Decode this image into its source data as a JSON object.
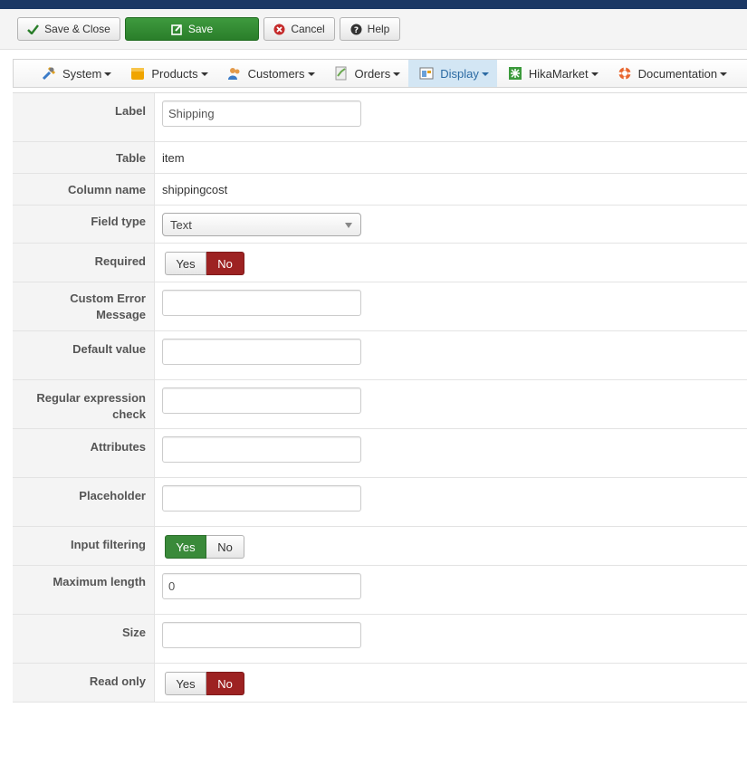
{
  "toolbar": {
    "save_close": "Save & Close",
    "save": "Save",
    "cancel": "Cancel",
    "help": "Help"
  },
  "menu": {
    "items": [
      {
        "label": "System",
        "icon": "tools-icon"
      },
      {
        "label": "Products",
        "icon": "products-icon"
      },
      {
        "label": "Customers",
        "icon": "customers-icon"
      },
      {
        "label": "Orders",
        "icon": "orders-icon"
      },
      {
        "label": "Display",
        "icon": "display-icon",
        "active": true
      },
      {
        "label": "HikaMarket",
        "icon": "hikamarket-icon"
      },
      {
        "label": "Documentation",
        "icon": "lifebuoy-icon"
      }
    ]
  },
  "form": {
    "label": {
      "key": "Label",
      "value": "Shipping"
    },
    "table": {
      "key": "Table",
      "value": "item"
    },
    "column_name": {
      "key": "Column name",
      "value": "shippingcost"
    },
    "field_type": {
      "key": "Field type",
      "value": "Text"
    },
    "required": {
      "key": "Required",
      "yes": "Yes",
      "no": "No",
      "selected": "No"
    },
    "custom_error": {
      "key": "Custom Error Message",
      "value": ""
    },
    "default_value": {
      "key": "Default value",
      "value": ""
    },
    "regex": {
      "key": "Regular expression check",
      "value": ""
    },
    "attributes": {
      "key": "Attributes",
      "value": ""
    },
    "placeholder": {
      "key": "Placeholder",
      "value": ""
    },
    "input_filtering": {
      "key": "Input filtering",
      "yes": "Yes",
      "no": "No",
      "selected": "Yes"
    },
    "max_length": {
      "key": "Maximum length",
      "value": "0"
    },
    "size": {
      "key": "Size",
      "value": ""
    },
    "read_only": {
      "key": "Read only",
      "yes": "Yes",
      "no": "No",
      "selected": "No"
    }
  },
  "colors": {
    "save_green": "#2f8a2f",
    "toggle_no_red": "#9d2222",
    "toggle_yes_green": "#3a8a3a",
    "menu_active": "#d3e6f4"
  }
}
